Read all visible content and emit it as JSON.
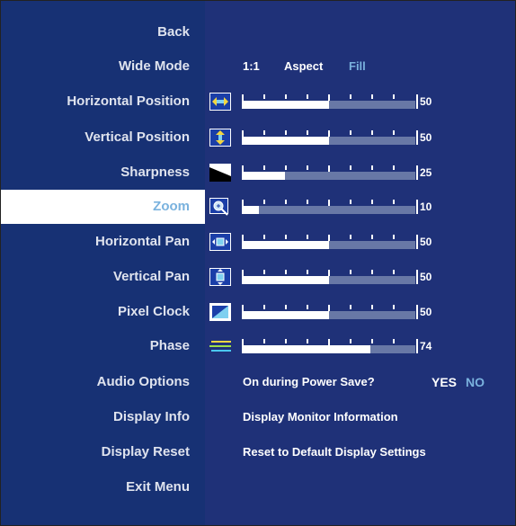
{
  "menu": [
    {
      "label": "Back",
      "selected": false
    },
    {
      "label": "Wide Mode",
      "selected": false
    },
    {
      "label": "Horizontal Position",
      "selected": false
    },
    {
      "label": "Vertical Position",
      "selected": false
    },
    {
      "label": "Sharpness",
      "selected": false
    },
    {
      "label": "Zoom",
      "selected": true
    },
    {
      "label": "Horizontal Pan",
      "selected": false
    },
    {
      "label": "Vertical Pan",
      "selected": false
    },
    {
      "label": "Pixel Clock",
      "selected": false
    },
    {
      "label": "Phase",
      "selected": false
    },
    {
      "label": "Audio Options",
      "selected": false
    },
    {
      "label": "Display Info",
      "selected": false
    },
    {
      "label": "Display Reset",
      "selected": false
    },
    {
      "label": "Exit Menu",
      "selected": false
    }
  ],
  "wide_mode": {
    "options": [
      "1:1",
      "Aspect",
      "Fill"
    ],
    "selected": "Fill"
  },
  "sliders": [
    {
      "name": "horizontal-position",
      "icon": "horizontal-position-icon",
      "value": 50,
      "value_label": "50"
    },
    {
      "name": "vertical-position",
      "icon": "vertical-position-icon",
      "value": 50,
      "value_label": "50"
    },
    {
      "name": "sharpness",
      "icon": "sharpness-icon",
      "value": 25,
      "value_label": "25"
    },
    {
      "name": "zoom",
      "icon": "zoom-icon",
      "value": 10,
      "value_label": "10"
    },
    {
      "name": "horizontal-pan",
      "icon": "horizontal-pan-icon",
      "value": 50,
      "value_label": "50"
    },
    {
      "name": "vertical-pan",
      "icon": "vertical-pan-icon",
      "value": 50,
      "value_label": "50"
    },
    {
      "name": "pixel-clock",
      "icon": "pixel-clock-icon",
      "value": 50,
      "value_label": "50"
    },
    {
      "name": "phase",
      "icon": "phase-icon",
      "value": 74,
      "value_label": "74"
    }
  ],
  "audio_options": {
    "question": "On during Power Save?",
    "yes_label": "YES",
    "no_label": "NO",
    "selected": "NO"
  },
  "display_info": {
    "text": "Display Monitor Information"
  },
  "display_reset": {
    "text": "Reset to Default Display Settings"
  },
  "colors": {
    "left_panel": "#173174",
    "right_panel": "#1f3178",
    "highlight_text": "#7ab2de",
    "selected_row_bg": "#ffffff"
  }
}
